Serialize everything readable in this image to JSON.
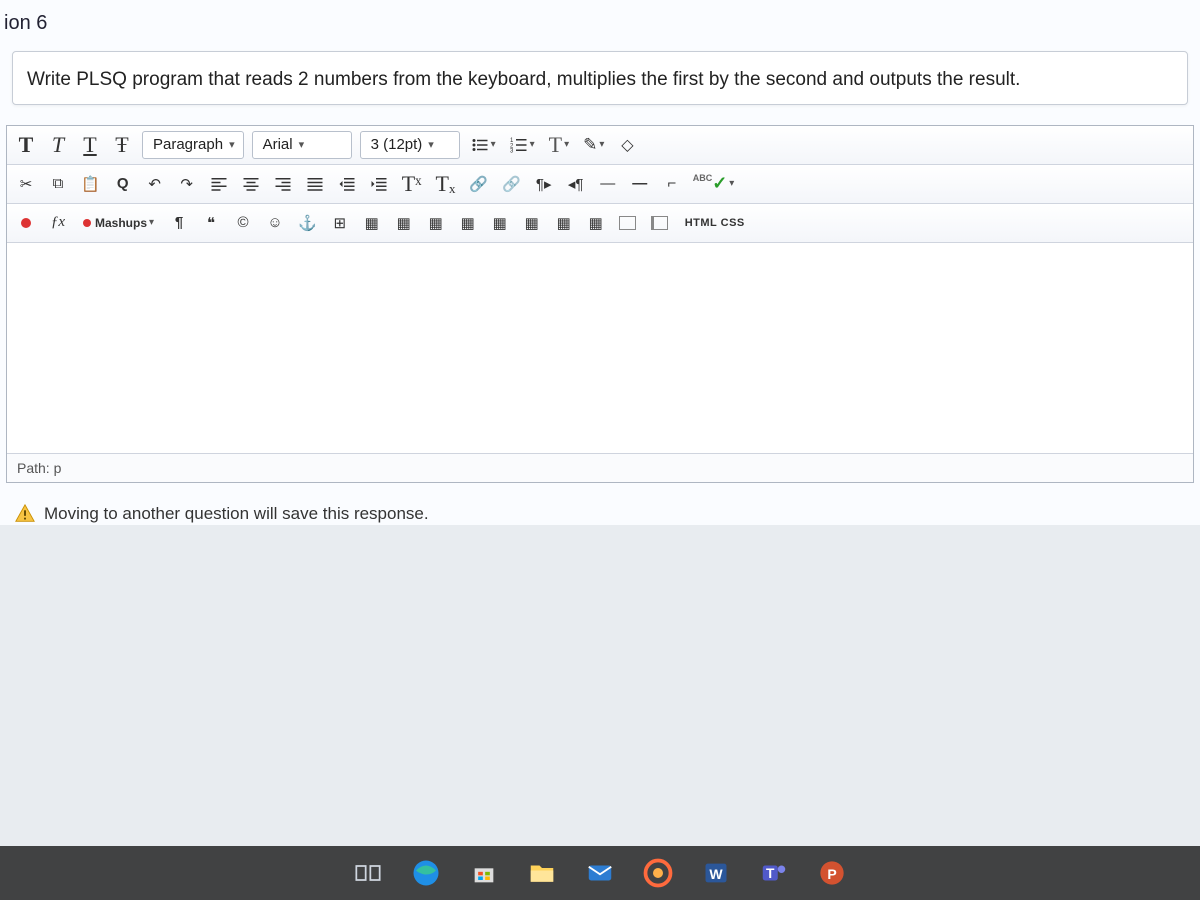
{
  "question": {
    "header": "ion 6",
    "text": "Write PLSQ program that reads 2 numbers from the keyboard, multiplies the first by the second and outputs the result."
  },
  "toolbar": {
    "row1": {
      "bold": "T",
      "italic": "T",
      "underline": "T",
      "strike": "Ŧ",
      "format_select": "Paragraph",
      "font_select": "Arial",
      "size_select": "3 (12pt)",
      "bullets": "≡",
      "numbers": "≡",
      "textcolor": "T",
      "highlight": "✎",
      "clear": "◈"
    },
    "row2": {
      "cut": "✂",
      "copy": "⧉",
      "paste": "⧉",
      "find": "Q",
      "undo": "↶",
      "redo": "↷",
      "alignL": "≡",
      "alignC": "≡",
      "alignR": "≡",
      "alignJ": "≡",
      "indent": "≡",
      "outdent": "≡",
      "sup": "Tˣ",
      "sub": "Tₓ",
      "link": "🔗",
      "unlink": "🔗",
      "ltr": "¶",
      "rtl": "¶",
      "hr1": "—",
      "hr2": "—",
      "nbsp": "⌐",
      "abc": "ABC",
      "check": "✓"
    },
    "row3": {
      "record": "●",
      "fx": "ƒx",
      "mashups": "Mashups",
      "pilcrow": "¶",
      "quote": "❝",
      "copyright": "©",
      "emoji": "☺",
      "anchor": "⚓",
      "table": "⊞",
      "html_label": "HTML CSS"
    }
  },
  "editor": {
    "path": "Path: p"
  },
  "warning": {
    "text": "Moving to another question will save this response."
  },
  "taskbar": {
    "items": [
      "task-view",
      "edge",
      "store",
      "explorer",
      "mail",
      "browser",
      "word",
      "teams",
      "powerpoint"
    ]
  }
}
